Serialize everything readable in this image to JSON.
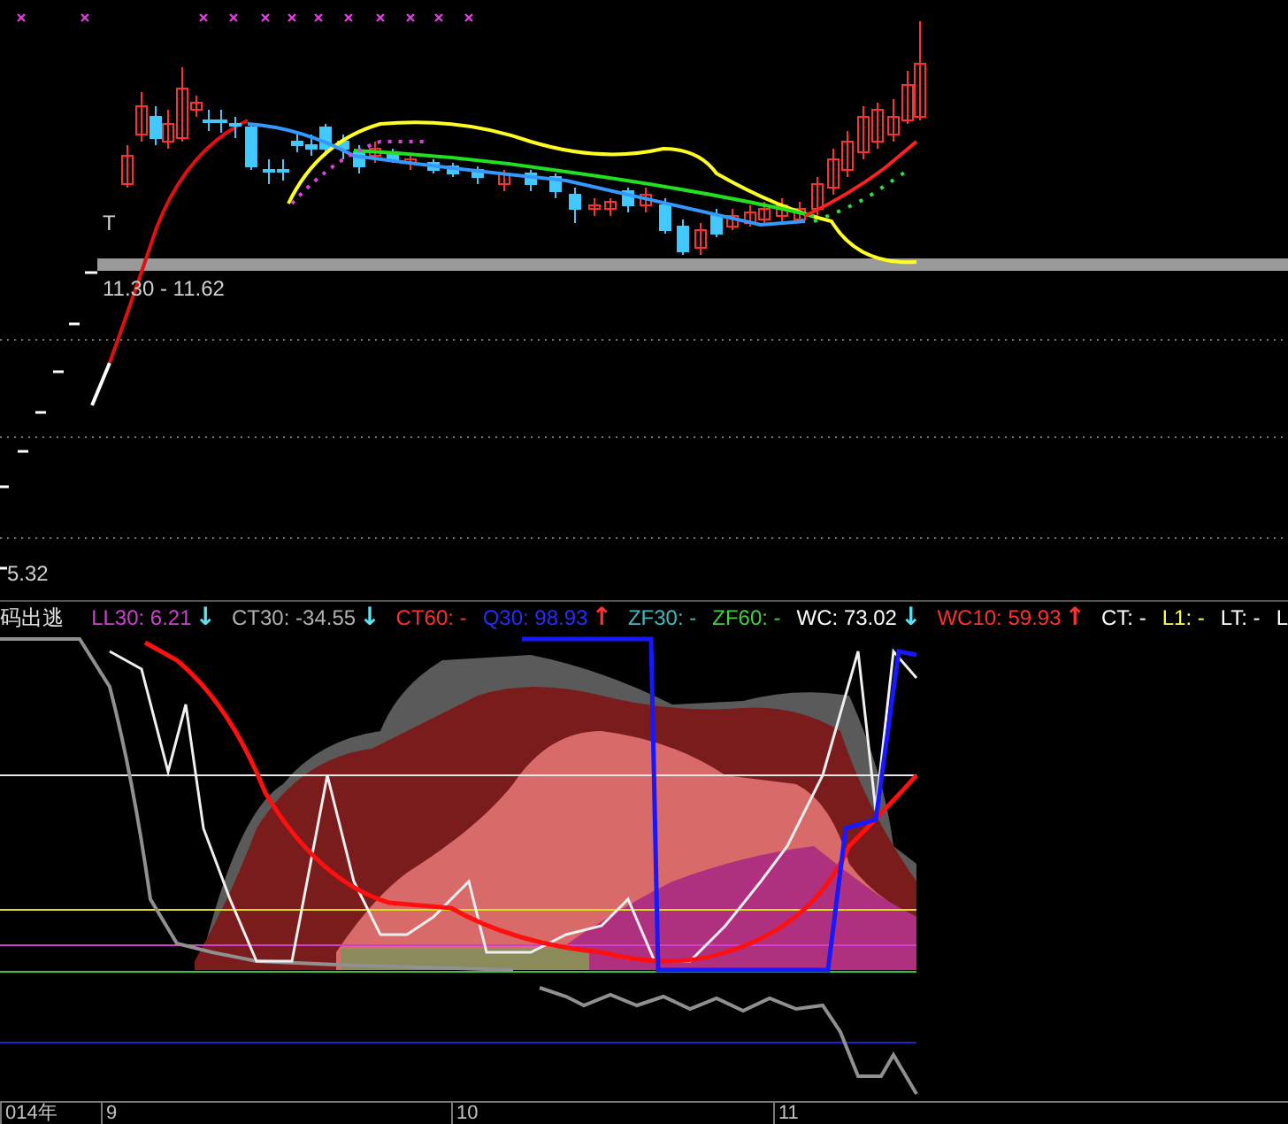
{
  "price_chart": {
    "marker": "T",
    "range_label": "11.30 - 11.62",
    "price_label": "5.32"
  },
  "indicator": {
    "title": "码出逃",
    "legend": [
      {
        "label": "LL30: 6.21",
        "color": "#d040d0",
        "arrow": {
          "text": "↓",
          "color": "#60e0f0"
        }
      },
      {
        "label": "CT30: -34.55",
        "color": "#b0b0b0",
        "arrow": {
          "text": "↓",
          "color": "#60e0f0"
        }
      },
      {
        "label": "CT60: -",
        "color": "#ff3030"
      },
      {
        "label": "Q30: 98.93",
        "color": "#2a2aff",
        "arrow": {
          "text": "↑",
          "color": "#ff3030"
        }
      },
      {
        "label": "ZF30: -",
        "color": "#40b8c0"
      },
      {
        "label": "ZF60: -",
        "color": "#40d040"
      },
      {
        "label": "WC: 73.02",
        "color": "#ffffff",
        "arrow": {
          "text": "↓",
          "color": "#60e0f0"
        }
      },
      {
        "label": "WC10: 59.93",
        "color": "#ff3030",
        "arrow": {
          "text": "↑",
          "color": "#ff3030"
        }
      },
      {
        "label": "CT: -",
        "color": "#ffffff"
      },
      {
        "label": "L1: -",
        "color": "#ffff40"
      },
      {
        "label": "LT: -",
        "color": "#ffffff"
      },
      {
        "label": "L",
        "color": "#ffffff"
      }
    ]
  },
  "time_axis": {
    "labels": [
      {
        "text": "014年"
      },
      {
        "text": "9"
      },
      {
        "text": "10"
      },
      {
        "text": "11"
      }
    ]
  }
}
